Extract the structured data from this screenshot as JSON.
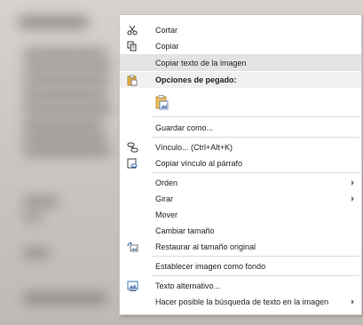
{
  "context_menu": {
    "items": [
      {
        "label": "Cortar",
        "icon": "scissors-icon"
      },
      {
        "label": "Copiar",
        "icon": "copy-icon"
      },
      {
        "label": "Copiar texto de la imagen",
        "icon": ""
      },
      {
        "label": "Opciones de pegado:",
        "icon": "paste-icon"
      },
      {
        "label": "",
        "icon": "paste-picture-icon"
      },
      {
        "label": "Guardar como...",
        "icon": ""
      },
      {
        "label": "Vínculo...  (Ctrl+Alt+K)",
        "icon": "link-icon"
      },
      {
        "label": "Copiar vínculo al párrafo",
        "icon": "link-paragraph-icon"
      },
      {
        "label": "Orden",
        "icon": ""
      },
      {
        "label": "Girar",
        "icon": ""
      },
      {
        "label": "Mover",
        "icon": ""
      },
      {
        "label": "Cambiar tamaño",
        "icon": ""
      },
      {
        "label": "Restaurar al tamaño original",
        "icon": "restore-size-icon"
      },
      {
        "label": "Establecer imagen como fondo",
        "icon": ""
      },
      {
        "label": "Texto alternativo...",
        "icon": "alt-text-icon"
      },
      {
        "label": "Hacer posible la búsqueda de texto en la imagen",
        "icon": ""
      }
    ],
    "highlighted_color": "#e3e3e3",
    "header_color": "#f0f0f0"
  }
}
